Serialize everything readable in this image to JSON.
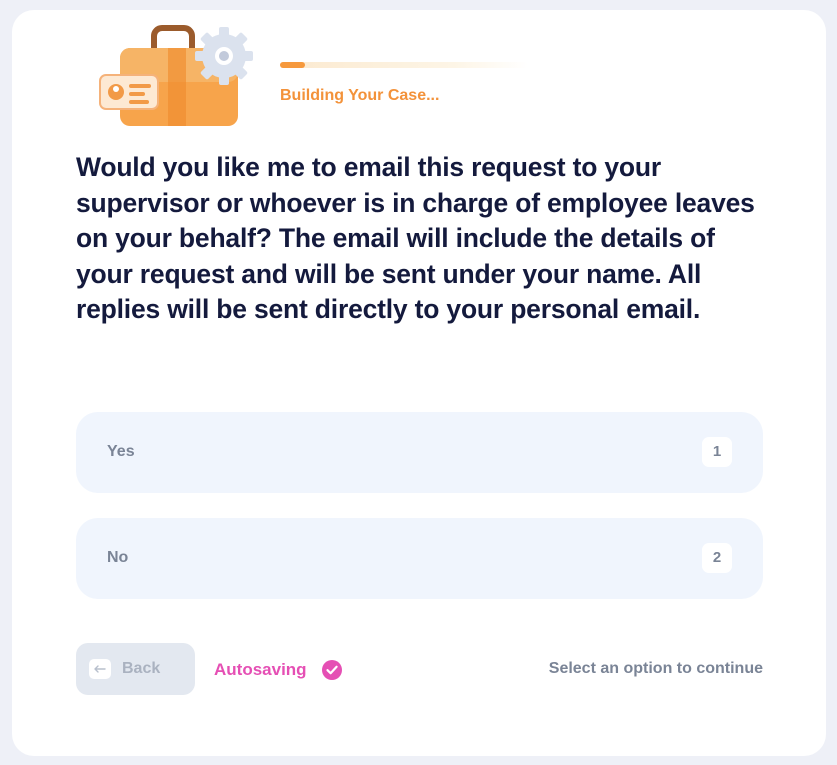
{
  "header": {
    "illustration": "briefcase-with-gear",
    "status_text": "Building Your Case...",
    "progress": 0.1
  },
  "question": {
    "text": "Would you like me to email this request to your supervisor or whoever is in charge of employee leaves on your behalf? The email will include the details of your request and will be sent under your name. All replies will be sent directly to your personal email."
  },
  "options": [
    {
      "label": "Yes",
      "key": "1"
    },
    {
      "label": "No",
      "key": "2"
    }
  ],
  "footer": {
    "back_label": "Back",
    "autosave_label": "Autosaving",
    "hint": "Select an option to continue"
  },
  "colors": {
    "accent_orange": "#f6993d",
    "autosave_pink": "#e54fb4",
    "option_bg": "#f0f5fd",
    "question_text": "#141a3d"
  }
}
